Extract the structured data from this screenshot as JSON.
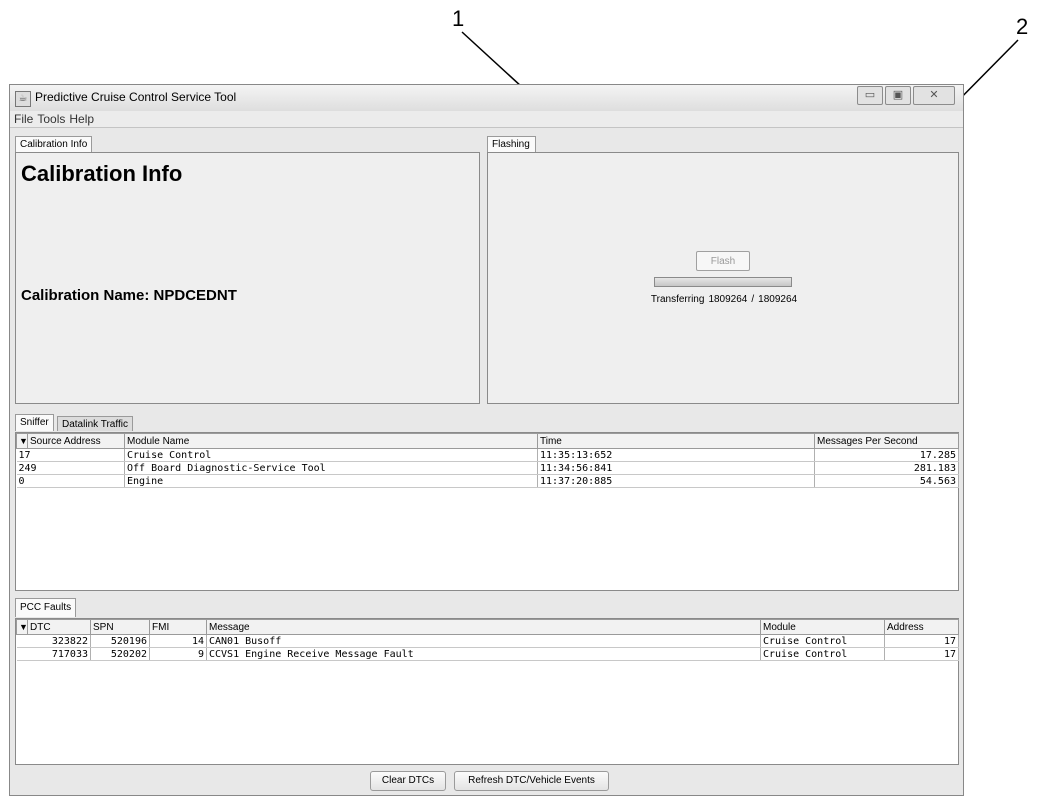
{
  "callouts": [
    "1",
    "2"
  ],
  "window": {
    "title": "Predictive Cruise Control Service Tool",
    "controls": [
      "minimize",
      "maximize",
      "close"
    ]
  },
  "menu": [
    "File",
    "Tools",
    "Help"
  ],
  "calibration": {
    "tab": "Calibration Info",
    "heading": "Calibration Info",
    "name_text": "Calibration Name: NPDCEDNT"
  },
  "flashing": {
    "tab": "Flashing",
    "button": "Flash",
    "progress": 1.0,
    "transfer_text": "Transferring",
    "transferred": "1809264",
    "separator": "/",
    "total": "1809264"
  },
  "sniffer": {
    "tabs": [
      "Sniffer",
      "Datalink Traffic"
    ],
    "filter_icon": "funnel-icon",
    "columns": [
      "Source Address",
      "Module Name",
      "Time",
      "Messages Per Second"
    ],
    "rows": [
      [
        "17",
        "Cruise Control",
        "11:35:13:652",
        "17.285"
      ],
      [
        "249",
        "Off Board Diagnostic-Service Tool",
        "11:34:56:841",
        "281.183"
      ],
      [
        "0",
        "Engine",
        "11:37:20:885",
        "54.563"
      ]
    ]
  },
  "faults": {
    "tab": "PCC Faults",
    "columns": [
      "DTC",
      "SPN",
      "FMI",
      "Message",
      "Module",
      "Address"
    ],
    "rows": [
      [
        "323822",
        "520196",
        "14",
        "CAN01 Busoff",
        "Cruise Control",
        "17"
      ],
      [
        "717033",
        "520202",
        "9",
        "CCVS1 Engine Receive Message Fault",
        "Cruise Control",
        "17"
      ]
    ],
    "clear_button": "Clear DTCs",
    "refresh_button": "Refresh DTC/Vehicle Events"
  }
}
